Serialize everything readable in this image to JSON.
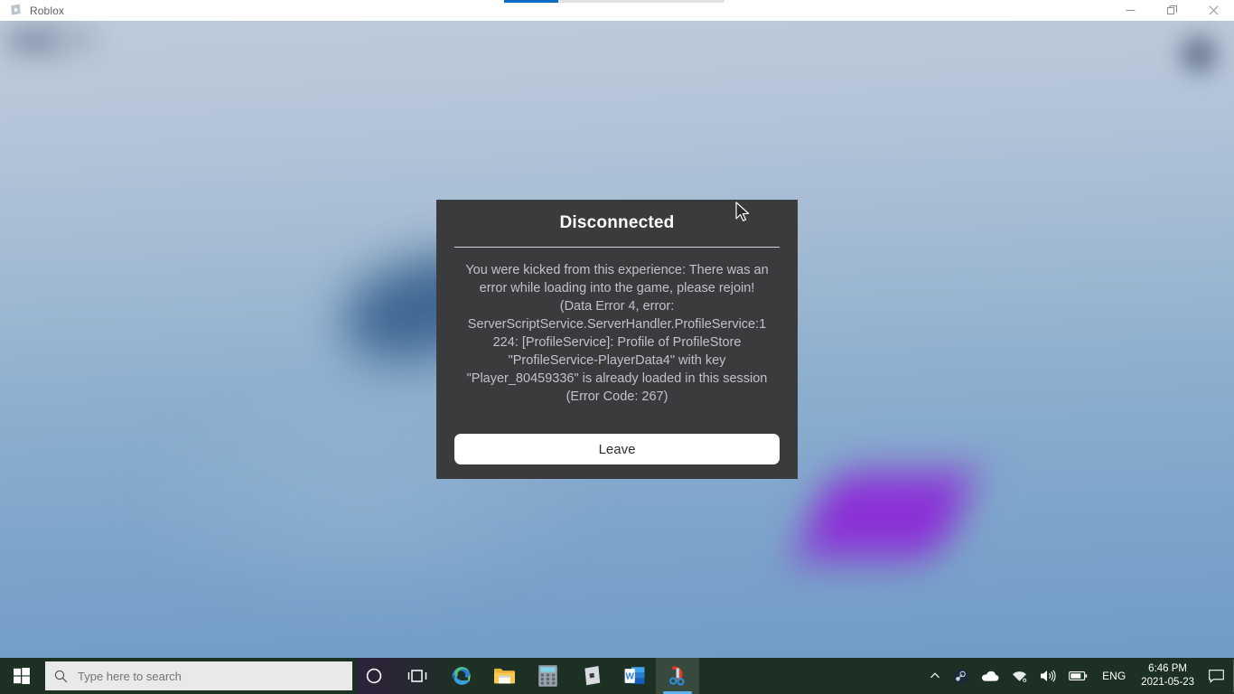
{
  "window": {
    "title": "Roblox",
    "app_icon": "roblox-icon",
    "controls": {
      "minimize": "minimize-icon",
      "restore": "restore-icon",
      "close": "close-icon"
    },
    "progress_percent": 25
  },
  "dialog": {
    "title": "Disconnected",
    "message": "You were kicked from this experience: There was an error while loading into the game, please rejoin!\n(Data Error 4, error:\nServerScriptService.ServerHandler.ProfileService:1\n224: [ProfileService]: Profile of ProfileStore\n\"ProfileService-PlayerData4\" with key\n\"Player_80459336\" is already loaded in this session\n(Error Code: 267)",
    "error_code": "267",
    "button_label": "Leave",
    "background_color": "#3b3b3d",
    "text_color": "#bfc2c6",
    "button_color": "#ffffff"
  },
  "taskbar": {
    "start_label": "start-button",
    "search": {
      "placeholder": "Type here to search",
      "value": "",
      "icon": "search-icon"
    },
    "items": [
      {
        "name": "cortana",
        "icon": "cortana-circle-icon",
        "label": "Cortana",
        "active": false,
        "running": false
      },
      {
        "name": "task-view",
        "icon": "task-view-icon",
        "label": "Task View",
        "active": false,
        "running": false
      },
      {
        "name": "edge",
        "icon": "edge-icon",
        "label": "Microsoft Edge",
        "active": false,
        "running": true
      },
      {
        "name": "file-explorer",
        "icon": "folder-icon",
        "label": "File Explorer",
        "active": false,
        "running": false
      },
      {
        "name": "calculator",
        "icon": "calculator-icon",
        "label": "Calculator",
        "active": false,
        "running": false
      },
      {
        "name": "roblox",
        "icon": "roblox-icon",
        "label": "Roblox",
        "active": false,
        "running": true
      },
      {
        "name": "word",
        "icon": "word-icon",
        "label": "Microsoft Word",
        "active": false,
        "running": true
      },
      {
        "name": "snipping-tool",
        "icon": "scissors-icon",
        "label": "Snipping Tool",
        "active": true,
        "running": true
      }
    ],
    "tray": {
      "overflow": "chevron-up-icon",
      "icons": [
        {
          "name": "steam",
          "icon": "steam-icon"
        },
        {
          "name": "onedrive",
          "icon": "cloud-icon"
        },
        {
          "name": "network",
          "icon": "wifi-icon"
        },
        {
          "name": "volume",
          "icon": "speaker-icon"
        },
        {
          "name": "battery",
          "icon": "battery-icon"
        }
      ],
      "language": "ENG",
      "time": "6:46 PM",
      "date": "2021-05-23",
      "action_center": "notification-icon"
    }
  },
  "colors": {
    "taskbar": "#1d3024",
    "accent": "#5eb3f0",
    "dialog_bg": "#3b3b3d",
    "sky_top": "#bccbdb",
    "sky_bottom": "#6f9cc6"
  }
}
